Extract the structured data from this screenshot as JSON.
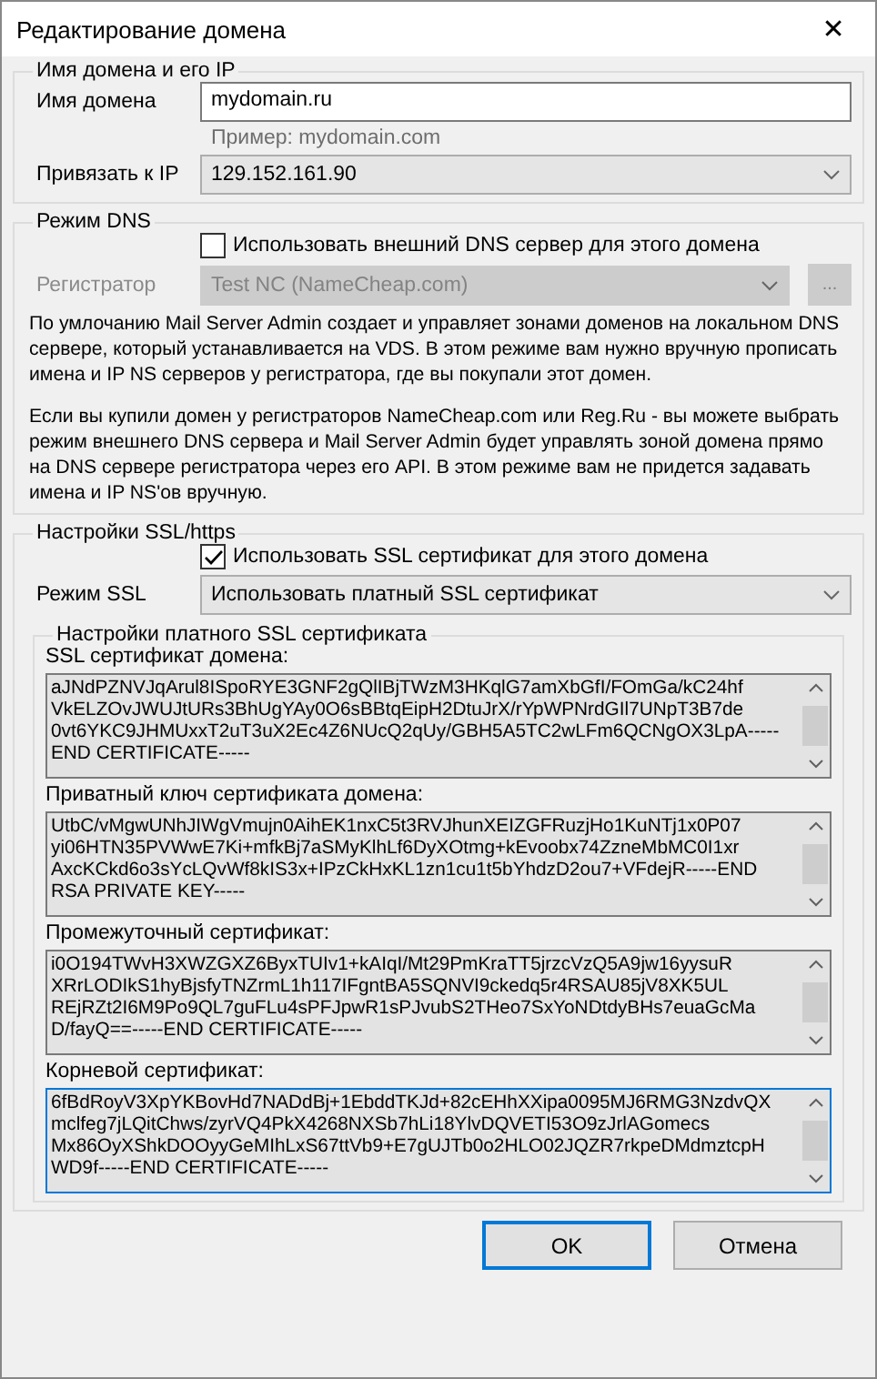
{
  "window": {
    "title": "Редактирование домена",
    "close": "✕"
  },
  "domain_group": {
    "title": "Имя домена и его IP",
    "domain_label": "Имя домена",
    "domain_value": "mydomain.ru",
    "hint": "Пример: mydomain.com",
    "ip_label": "Привязать к IP",
    "ip_value": "129.152.161.90"
  },
  "dns_group": {
    "title": "Режим DNS",
    "external_dns": {
      "label": "Использовать внешний DNS сервер для этого домена",
      "checked": false
    },
    "registrar_label": "Регистратор",
    "registrar_value": "Test NC (NameCheap.com)",
    "registrar_disabled": true,
    "more_button": "...",
    "paragraphs": [
      "По умлочанию Mail Server Admin создает и управляет зонами доменов на локальном DNS сервере, который устанавливается на VDS. В этом режиме вам нужно вручную прописать имена и IP NS серверов у регистратора, где вы покупали этот домен.",
      "Если вы купили домен у регистраторов NameCheap.com или Reg.Ru - вы можете выбрать режим внешнего DNS сервера и Mail Server Admin будет управлять зоной домена прямо на DNS сервере регистратора через его API. В этом режиме вам не придется задавать имена и IP NS'ов вручную."
    ]
  },
  "ssl_group": {
    "title": "Настройки SSL/https",
    "use_ssl": {
      "label": "Использовать SSL сертификат для этого домена",
      "checked": true
    },
    "mode_label": "Режим SSL",
    "mode_value": "Использовать платный SSL сертификат",
    "paid": {
      "title": "Настройки платного SSL сертификата",
      "fields": [
        {
          "label": "SSL сертификат домена:",
          "focused": false,
          "value": "aJNdPZNVJqArul8ISpoRYE3GNF2gQlIBjTWzM3HKqlG7amXbGfI/FOmGa/kC24hf\nVkELZOvJWUJtURs3BhUgYAy0O6sBBtqEipH2DtuJrX/rYpWPNrdGIl7UNpT3B7de\n0vt6YKC9JHMUxxT2uT3uX2Ec4Z6NUcQ2qUy/GBH5A5TC2wLFm6QCNgOX3LpA-----\nEND CERTIFICATE-----"
        },
        {
          "label": "Приватный ключ сертификата домена:",
          "focused": false,
          "value": "UtbC/vMgwUNhJIWgVmujn0AihEK1nxC5t3RVJhunXEIZGFRuzjHo1KuNTj1x0P07\nyi06HTN35PVWwE7Ki+mfkBj7aSMyKlhLf6DyXOtmg+kEvoobx74ZzneMbMC0I1xr\nAxcKCkd6o3sYcLQvWf8kIS3x+IPzCkHxKL1zn1cu1t5bYhdzD2ou7+VFdejR-----END\nRSA PRIVATE KEY-----"
        },
        {
          "label": "Промежуточный сертификат:",
          "focused": false,
          "value": "i0O194TWvH3XWZGXZ6ByxTUIv1+kAIqI/Mt29PmKraTT5jrzcVzQ5A9jw16yysuR\nXRrLODIkS1hyBjsfyTNZrmL1h117IFgntBA5SQNVI9ckedq5r4RSAU85jV8XK5UL\nREjRZt2I6M9Po9QL7guFLu4sPFJpwR1sPJvubS2THeo7SxYoNDtdyBHs7euaGcMa\nD/fayQ==-----END CERTIFICATE-----"
        },
        {
          "label": "Корневой сертификат:",
          "focused": true,
          "value": "6fBdRoyV3XpYKBovHd7NADdBj+1EbddTKJd+82cEHhXXipa0095MJ6RMG3NzdvQX\nmclfeg7jLQitChws/zyrVQ4PkX4268NXSb7hLi18YlvDQVETI53O9zJrlAGomecs\nMx86OyXShkDOOyyGeMIhLxS67ttVb9+E7gUJTb0o2HLO02JQZR7rkpeDMdmztcpH\nWD9f-----END CERTIFICATE-----"
        }
      ]
    }
  },
  "buttons": [
    {
      "label": "OK",
      "default": true
    },
    {
      "label": "Отмена",
      "default": false
    }
  ]
}
